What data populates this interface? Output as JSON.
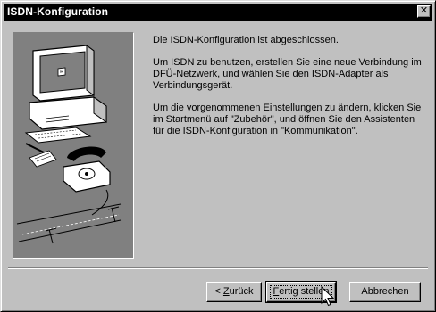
{
  "window": {
    "title": "ISDN-Konfiguration",
    "close_glyph": "✕"
  },
  "illustration": {
    "icon": "computer-phone-network-illustration"
  },
  "content": {
    "paragraphs": [
      "Die ISDN-Konfiguration ist abgeschlossen.",
      "Um ISDN zu benutzen, erstellen Sie eine neue Verbindung im DFÜ-Netzwerk, und wählen Sie den ISDN-Adapter als Verbindungsgerät.",
      "Um die vorgenommenen Einstellungen zu ändern, klicken Sie im Startmenü auf \"Zubehör\", und öffnen Sie den Assistenten für die ISDN-Konfiguration in \"Kommunikation\"."
    ]
  },
  "buttons": {
    "back_prefix": "< ",
    "back_mnemonic": "Z",
    "back_rest": "urück",
    "finish_mnemonic": "F",
    "finish_rest": "ertig stellen",
    "cancel": "Abbrechen"
  },
  "colors": {
    "face": "#c0c0c0",
    "titlebar": "#000000",
    "panel": "#808080"
  }
}
